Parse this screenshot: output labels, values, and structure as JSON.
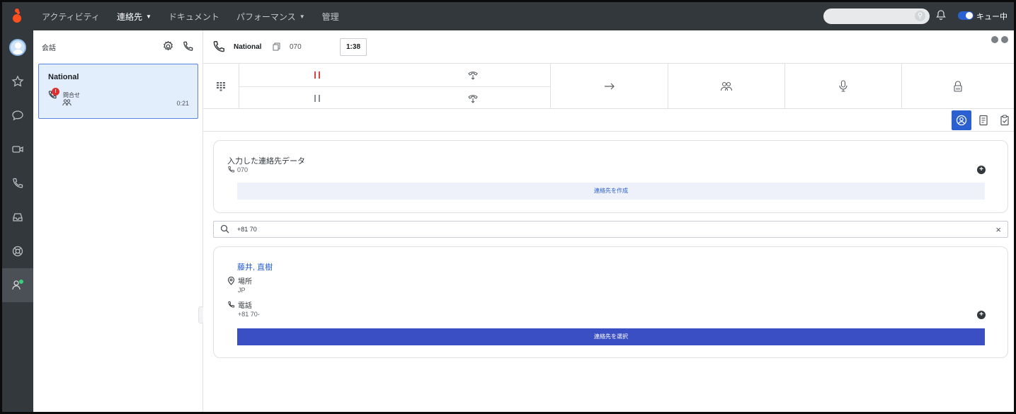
{
  "topbar": {
    "nav": [
      {
        "label": "アクティビティ",
        "active": false,
        "dropdown": false
      },
      {
        "label": "連絡先",
        "active": true,
        "dropdown": true
      },
      {
        "label": "ドキュメント",
        "active": false,
        "dropdown": false
      },
      {
        "label": "パフォーマンス",
        "active": false,
        "dropdown": true
      },
      {
        "label": "管理",
        "active": false,
        "dropdown": false
      }
    ],
    "search_placeholder": "",
    "queue_label": "キュー中",
    "queue_on": true
  },
  "rail": {
    "items": [
      "avatar",
      "star-icon",
      "chat-icon",
      "video-icon",
      "phone-icon",
      "inbox-icon",
      "support-icon",
      "contacts-icon"
    ],
    "active_index": 7
  },
  "conversations": {
    "title": "会話",
    "items": [
      {
        "name": "National",
        "status": "問合せ",
        "badge": "!",
        "time": "0:21"
      }
    ]
  },
  "call": {
    "name": "National",
    "number": "070",
    "timer": "1:38"
  },
  "contact_data_card": {
    "title": "入力した連絡先データ",
    "phone": "070",
    "create_button": "連絡先を作成"
  },
  "search": {
    "value": "+81 70"
  },
  "contact_result": {
    "name": "藤井, 直樹",
    "location_label": "場所",
    "location_value": "JP",
    "phone_label": "電話",
    "phone_value": "+81 70-",
    "select_button": "連絡先を選択"
  },
  "colors": {
    "topbar": "#33383d",
    "accent": "#2a60d0",
    "primary_button": "#3b4fc4",
    "hold_red": "#d64545",
    "selected_card": "#e3eefc"
  }
}
